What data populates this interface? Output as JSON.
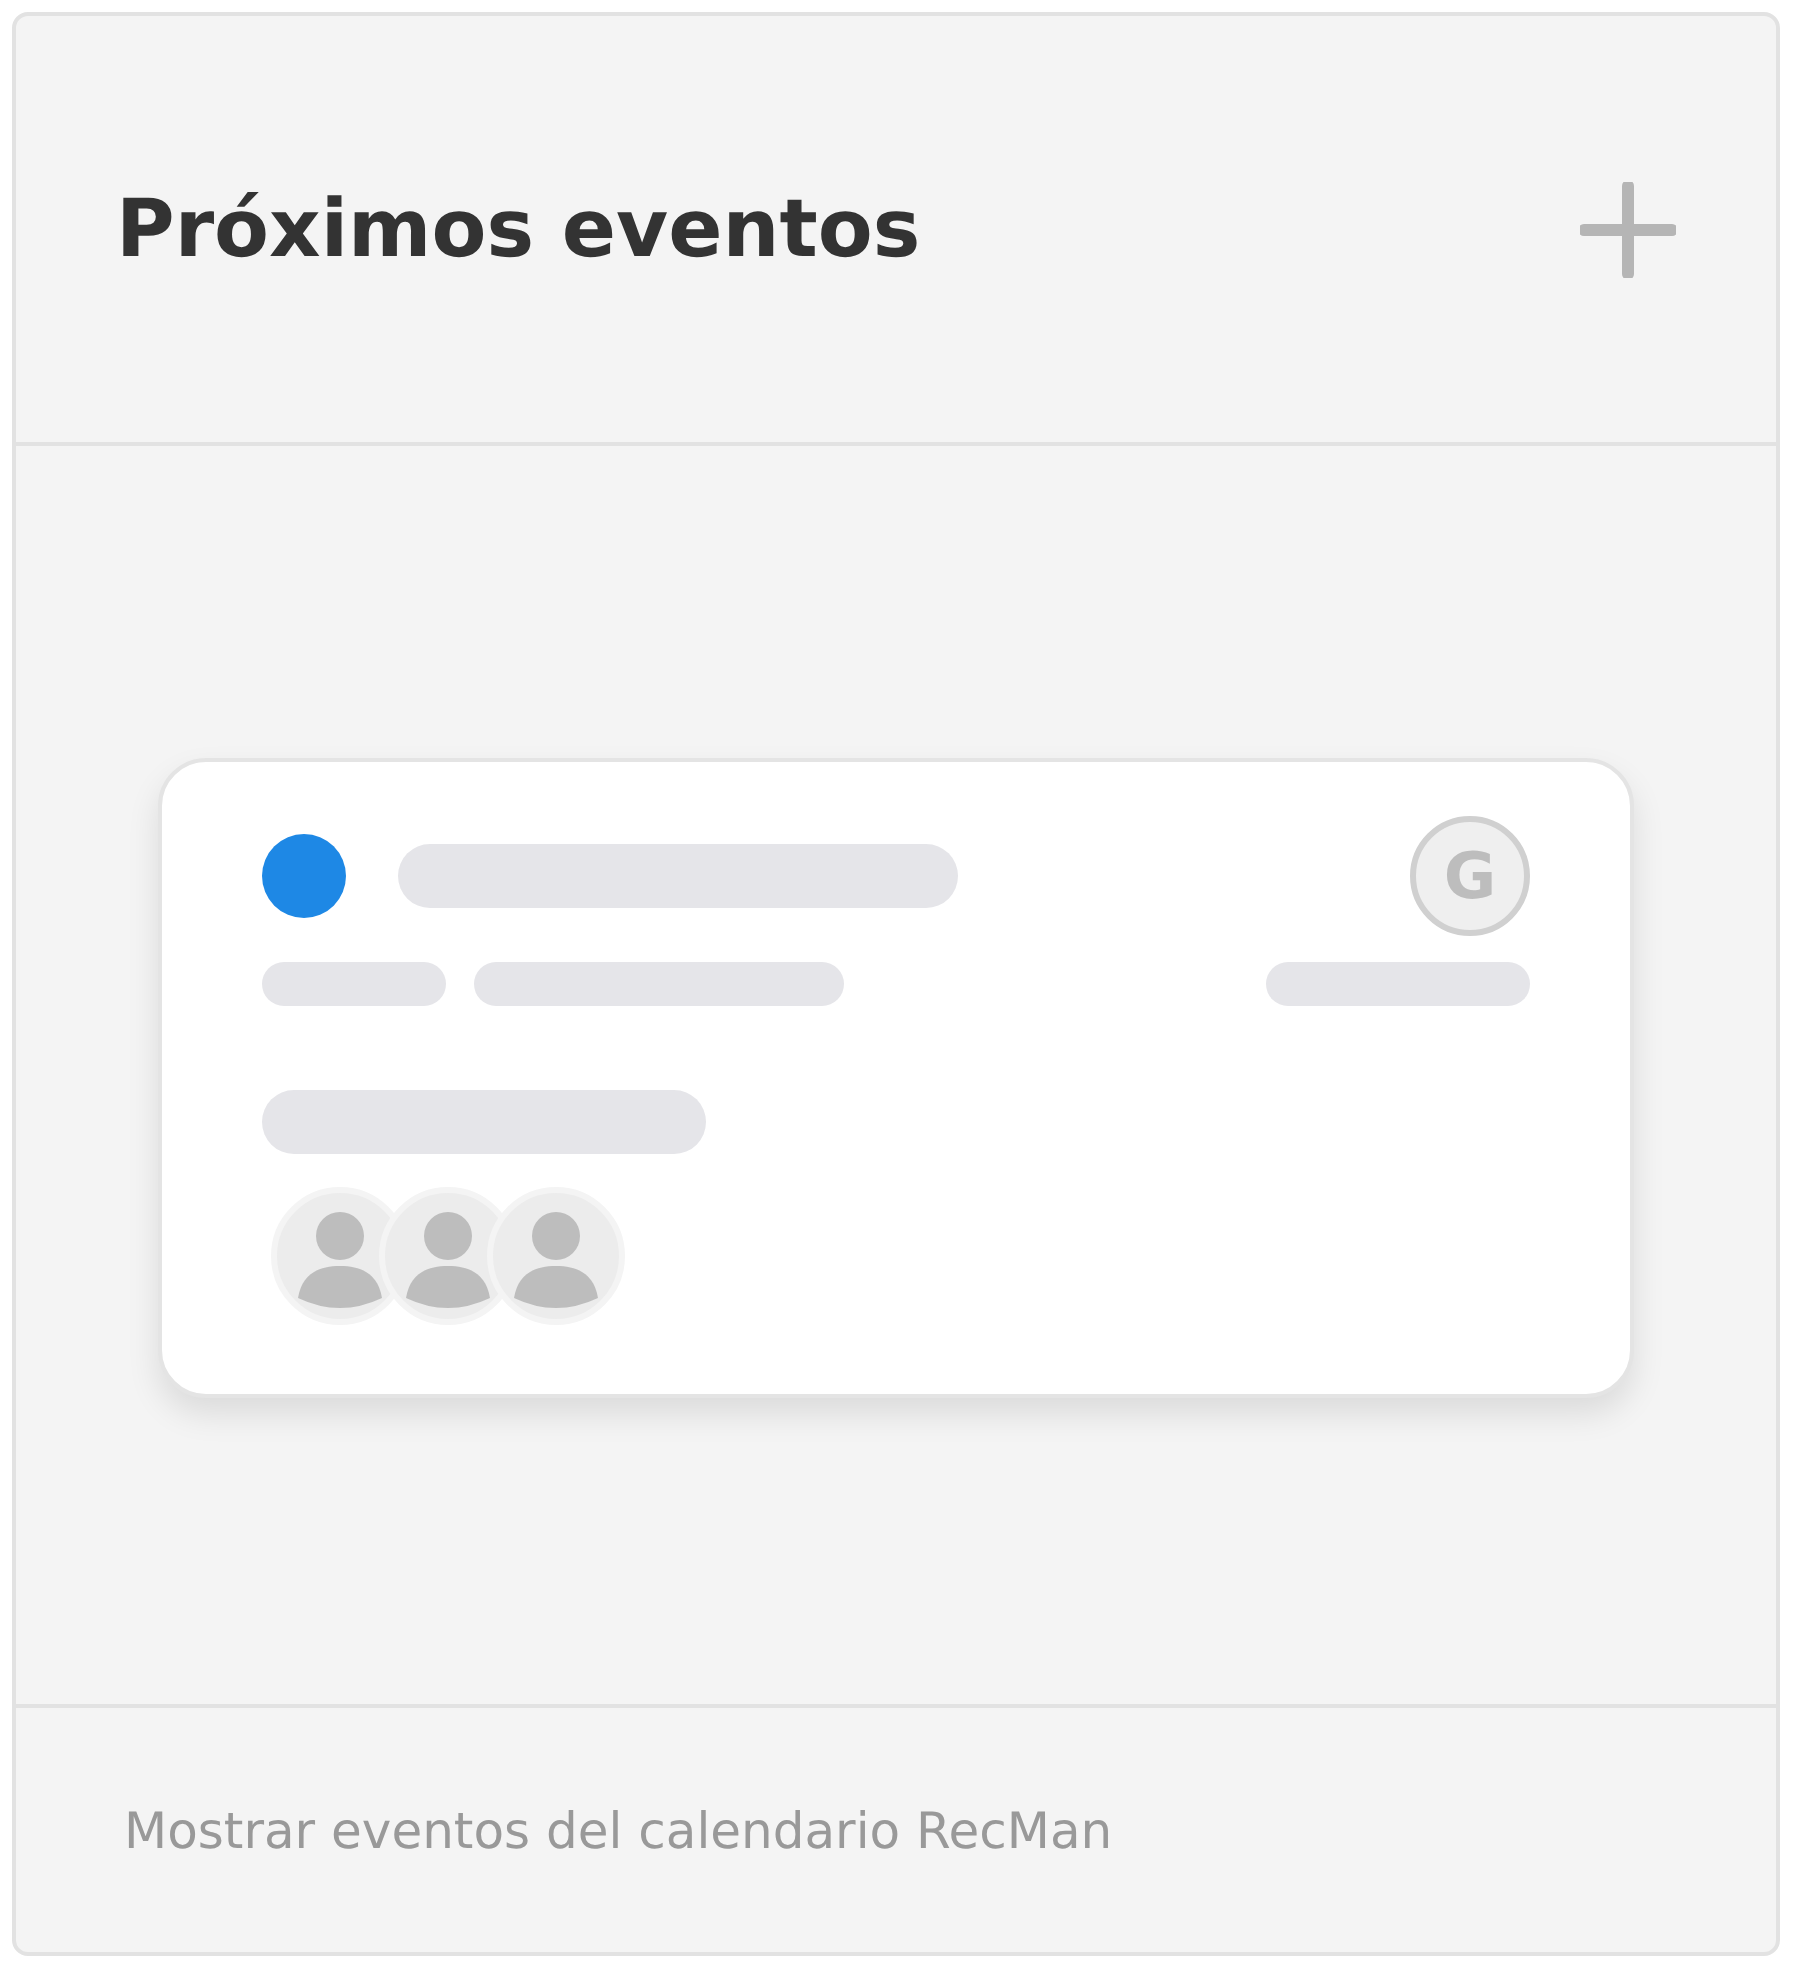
{
  "panel": {
    "title": "Próximos eventos"
  },
  "preview_card": {
    "source_badge": "G"
  },
  "footer": {
    "text": "Mostrar eventos del calendario RecMan"
  }
}
